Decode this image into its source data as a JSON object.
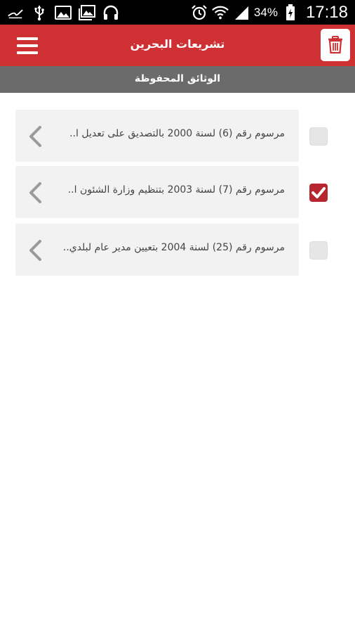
{
  "status_bar": {
    "battery": "34%",
    "time": "17:18"
  },
  "app_bar": {
    "title": "تشريعات البحرين"
  },
  "section": {
    "title": "الوثائق المحفوظة"
  },
  "documents": [
    {
      "title": "مرسوم رقم (6) لسنة 2000 بالتصديق على تعديل ا..",
      "checked": false
    },
    {
      "title": "مرسوم رقم (7) لسنة 2003 بتنظيم وزارة الشئون ا..",
      "checked": true
    },
    {
      "title": "مرسوم رقم (25) لسنة 2004 بتعيين مدير عام لبلدي..",
      "checked": false
    }
  ],
  "colors": {
    "primary": "#cf3033",
    "subheader": "#6b6b6b",
    "card": "#f2f2f2",
    "checked": "#b72630"
  }
}
